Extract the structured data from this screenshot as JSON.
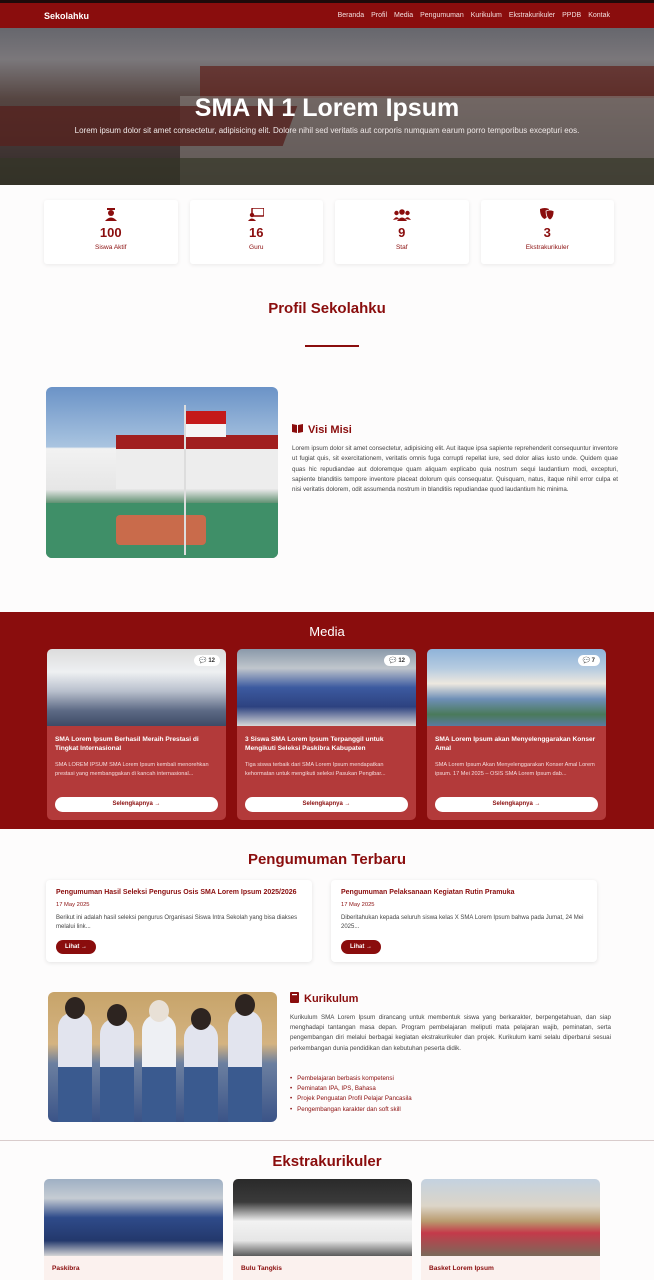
{
  "navbar": {
    "brand": "Sekolahku",
    "links": [
      "Beranda",
      "Profil",
      "Media",
      "Pengumuman",
      "Kurikulum",
      "Ekstrakurikuler",
      "PPDB",
      "Kontak"
    ]
  },
  "hero": {
    "title": "SMA N 1 Lorem Ipsum",
    "subtitle": "Lorem ipsum dolor sit amet consectetur, adipisicing elit. Dolore nihil sed veritatis aut corporis numquam earum porro temporibus excepturi eos."
  },
  "stats": [
    {
      "icon": "graduation-icon",
      "value": "100",
      "label": "Siswa Aktif"
    },
    {
      "icon": "teacher-icon",
      "value": "16",
      "label": "Guru"
    },
    {
      "icon": "users-icon",
      "value": "9",
      "label": "Staf"
    },
    {
      "icon": "masks-icon",
      "value": "3",
      "label": "Ekstrakurikuler"
    }
  ],
  "profil": {
    "title": "Profil Sekolahku",
    "visi_title": "Visi Misi",
    "visi_text": "Lorem ipsum dolor sit amet consectetur, adipisicing elit. Aut itaque ipsa sapiente reprehenderit consequuntur inventore ut fugiat quis, sit exercitationem, veritatis omnis fuga corrupti repellat iure, sed dolor alias iusto unde. Quidem quae quas hic repudiandae aut doloremque quam aliquam explicabo quia nostrum sequi laudantium modi, excepturi, sapiente blanditiis tempore inventore placeat dolorum quis consequatur. Quisquam, natus, itaque nihil error culpa et nisi veritatis dolorem, odit assumenda nostrum in blanditiis repudiandae quod laudantium hic minima."
  },
  "media": {
    "title": "Media",
    "cards": [
      {
        "badge": "12",
        "title": "SMA Lorem Ipsum Berhasil Meraih Prestasi di Tingkat Internasional",
        "desc": "SMA LOREM IPSUM SMA Lorem Ipsum kembali menorehkan prestasi yang membanggakan di kancah internasional...",
        "button": "Selengkapnya →"
      },
      {
        "badge": "12",
        "title": "3 Siswa SMA Lorem Ipsum Terpanggil untuk Mengikuti Seleksi Paskibra Kabupaten",
        "desc": "Tiga siswa terbaik dari SMA Lorem Ipsum mendapatkan kehormatan untuk mengikuti seleksi Pasukan Pengibar...",
        "button": "Selengkapnya →"
      },
      {
        "badge": "7",
        "title": "SMA Lorem Ipsum akan Menyelenggarakan Konser Amal",
        "desc": "SMA Lorem Ipsum Akan Menyelenggarakan Konser Amal Lorem ipsum. 17 Mei 2025 – OSIS SMA Lorem Ipsum dab...",
        "button": "Selengkapnya →"
      }
    ]
  },
  "pengumuman": {
    "title": "Pengumuman Terbaru",
    "items": [
      {
        "title": "Pengumuman Hasil Seleksi Pengurus Osis SMA Lorem Ipsum 2025/2026",
        "date": "17 May 2025",
        "desc": "Berikut ini adalah hasil seleksi pengurus Organisasi Siswa Intra Sekolah yang bisa diakses melalui link...",
        "button": "Lihat →"
      },
      {
        "title": "Pengumuman Pelaksanaan Kegiatan Rutin Pramuka",
        "date": "17 May 2025",
        "desc": "Diberitahukan kepada seluruh siswa kelas X SMA Lorem Ipsum bahwa pada Jumat, 24 Mei 2025...",
        "button": "Lihat →"
      }
    ]
  },
  "kurikulum": {
    "title": "Kurikulum",
    "text": "Kurikulum SMA Lorem Ipsum dirancang untuk membentuk siswa yang berkarakter, berpengetahuan, dan siap menghadapi tantangan masa depan. Program pembelajaran meliputi mata pelajaran wajib, peminatan, serta pengembangan diri melalui berbagai kegiatan ekstrakurikuler dan projek. Kurikulum kami selalu diperbarui sesuai perkembangan dunia pendidikan dan kebutuhan peserta didik.",
    "points": [
      "Pembelajaran berbasis kompetensi",
      "Peminatan IPA, IPS, Bahasa",
      "Projek Penguatan Profil Pelajar Pancasila",
      "Pengembangan karakter dan soft skill"
    ]
  },
  "ekstrakurikuler": {
    "title": "Ekstrakurikuler",
    "cards": [
      {
        "title": "Paskibra"
      },
      {
        "title": "Bulu Tangkis"
      },
      {
        "title": "Basket Lorem Ipsum"
      }
    ]
  },
  "colors": {
    "primary": "#8a0d0d",
    "card": "#b33a3a"
  }
}
